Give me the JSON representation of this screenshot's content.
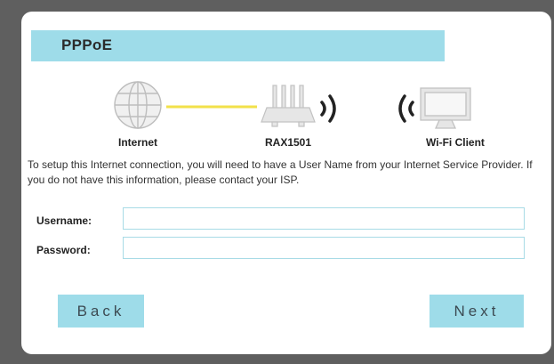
{
  "header": {
    "title": "PPPoE"
  },
  "diagram": {
    "internet_label": "Internet",
    "router_label": "RAX1501",
    "client_label": "Wi-Fi Client"
  },
  "description": "To setup this Internet connection, you will need to have a User Name from your Internet Service Provider. If you do not have this information, please contact your ISP.",
  "form": {
    "username_label": "Username:",
    "username_value": "",
    "password_label": "Password:",
    "password_value": ""
  },
  "buttons": {
    "back_label": "Back",
    "next_label": "Next"
  },
  "colors": {
    "accent": "#9edce9",
    "link_line": "#f2e14a",
    "icon_gray": "#c7c7c7"
  }
}
